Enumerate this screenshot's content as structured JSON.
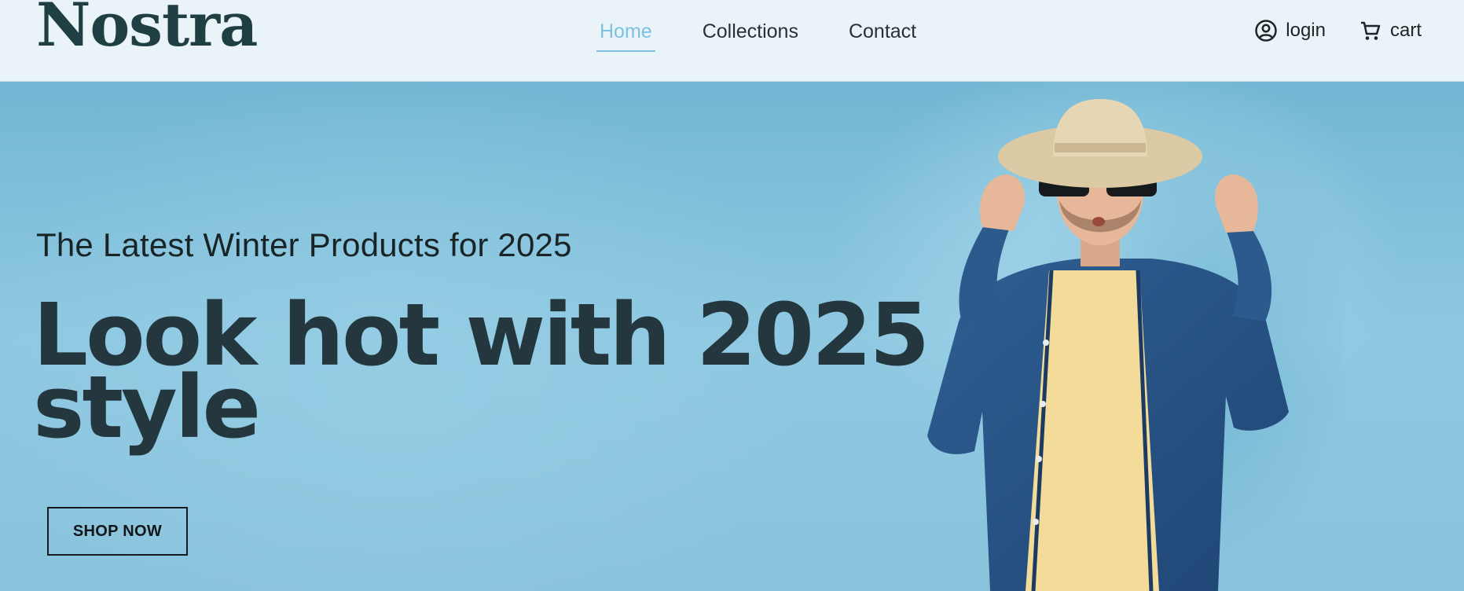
{
  "brand": {
    "logo_text": "Nostra"
  },
  "nav": {
    "links": [
      {
        "label": "Home",
        "active": true
      },
      {
        "label": "Collections",
        "active": false
      },
      {
        "label": "Contact",
        "active": false
      }
    ],
    "login_label": "login",
    "cart_label": "cart",
    "login_icon": "user-circle-icon",
    "cart_icon": "shopping-cart-icon"
  },
  "hero": {
    "subtitle": "The Latest Winter Products for 2025",
    "title": "Look hot with 2025 style",
    "cta_label": "SHOP NOW"
  },
  "colors": {
    "navbar_bg": "#eaf3f8",
    "active_link": "#7cc1df",
    "hero_bg": "#8fc8df",
    "headline": "#24363e"
  }
}
